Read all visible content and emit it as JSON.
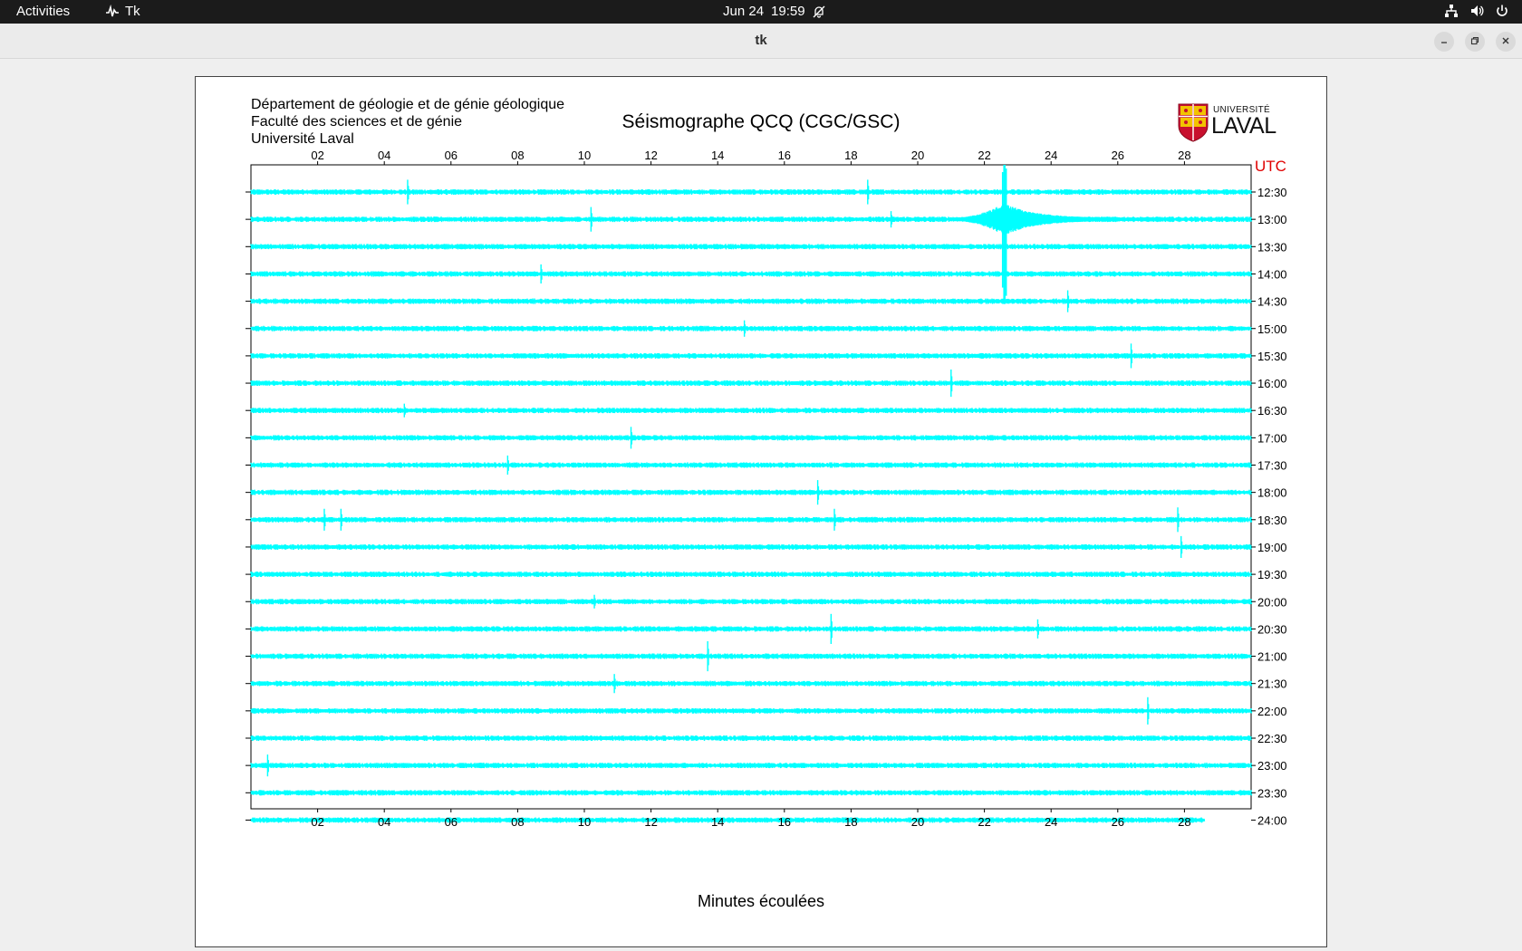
{
  "topbar": {
    "activities": "Activities",
    "app_name": "Tk",
    "date": "Jun 24",
    "time": "19:59",
    "icons": [
      "network-icon",
      "volume-icon",
      "power-icon",
      "notifications-off-icon"
    ]
  },
  "window": {
    "title": "tk",
    "buttons": [
      "minimize",
      "restore",
      "close"
    ]
  },
  "seismogram": {
    "header_lines": [
      "Département de géologie et de génie géologique",
      "Faculté des sciences et de génie",
      "Université Laval"
    ],
    "title": "Séismographe QCQ (CGC/GSC)",
    "logo": {
      "small": "UNIVERSITÉ",
      "big": "LAVAL"
    },
    "utc_label": "UTC",
    "xlabel": "Minutes écoulées",
    "trace_color": "#00ffff",
    "utc_color": "#e00000"
  },
  "chart_data": {
    "type": "line",
    "title": "Séismographe QCQ (CGC/GSC)",
    "xlabel": "Minutes écoulées",
    "ylabel": "",
    "xlim": [
      0,
      30
    ],
    "x_ticks": [
      "02",
      "04",
      "06",
      "08",
      "10",
      "12",
      "14",
      "16",
      "18",
      "20",
      "22",
      "24",
      "26",
      "28"
    ],
    "row_labels": [
      "12:30",
      "13:00",
      "13:30",
      "14:00",
      "14:30",
      "15:00",
      "15:30",
      "16:00",
      "16:30",
      "17:00",
      "17:30",
      "18:00",
      "18:30",
      "19:00",
      "19:30",
      "20:00",
      "20:30",
      "21:00",
      "21:30",
      "22:00",
      "22:30",
      "23:00",
      "23:30",
      "24:00"
    ],
    "last_row_end_minute": 28.6,
    "events": [
      {
        "row": 0,
        "minute": 4.7,
        "amplitude": 0.45
      },
      {
        "row": 0,
        "minute": 18.5,
        "amplitude": 0.45
      },
      {
        "row": 1,
        "minute": 10.2,
        "amplitude": 0.45
      },
      {
        "row": 1,
        "minute": 19.2,
        "amplitude": 0.3
      },
      {
        "row": 3,
        "minute": 8.7,
        "amplitude": 0.35
      },
      {
        "row": 4,
        "minute": 24.5,
        "amplitude": 0.4
      },
      {
        "row": 5,
        "minute": 14.8,
        "amplitude": 0.3
      },
      {
        "row": 6,
        "minute": 26.4,
        "amplitude": 0.45
      },
      {
        "row": 7,
        "minute": 21.0,
        "amplitude": 0.5
      },
      {
        "row": 8,
        "minute": 4.6,
        "amplitude": 0.25
      },
      {
        "row": 9,
        "minute": 11.4,
        "amplitude": 0.4
      },
      {
        "row": 10,
        "minute": 7.7,
        "amplitude": 0.35
      },
      {
        "row": 11,
        "minute": 17.0,
        "amplitude": 0.45
      },
      {
        "row": 12,
        "minute": 2.2,
        "amplitude": 0.4
      },
      {
        "row": 12,
        "minute": 2.7,
        "amplitude": 0.4
      },
      {
        "row": 12,
        "minute": 17.5,
        "amplitude": 0.4
      },
      {
        "row": 12,
        "minute": 27.8,
        "amplitude": 0.45
      },
      {
        "row": 13,
        "minute": 27.9,
        "amplitude": 0.4
      },
      {
        "row": 15,
        "minute": 10.3,
        "amplitude": 0.25
      },
      {
        "row": 16,
        "minute": 17.4,
        "amplitude": 0.55
      },
      {
        "row": 16,
        "minute": 23.6,
        "amplitude": 0.35
      },
      {
        "row": 17,
        "minute": 13.7,
        "amplitude": 0.55
      },
      {
        "row": 18,
        "minute": 10.9,
        "amplitude": 0.35
      },
      {
        "row": 19,
        "minute": 26.9,
        "amplitude": 0.5
      },
      {
        "row": 21,
        "minute": 0.5,
        "amplitude": 0.4
      }
    ],
    "earthquake": {
      "row": 1,
      "onset_minute": 21.0,
      "peak_minute": 22.6,
      "end_minute": 27.0,
      "peak_amplitude": 2.0
    }
  }
}
